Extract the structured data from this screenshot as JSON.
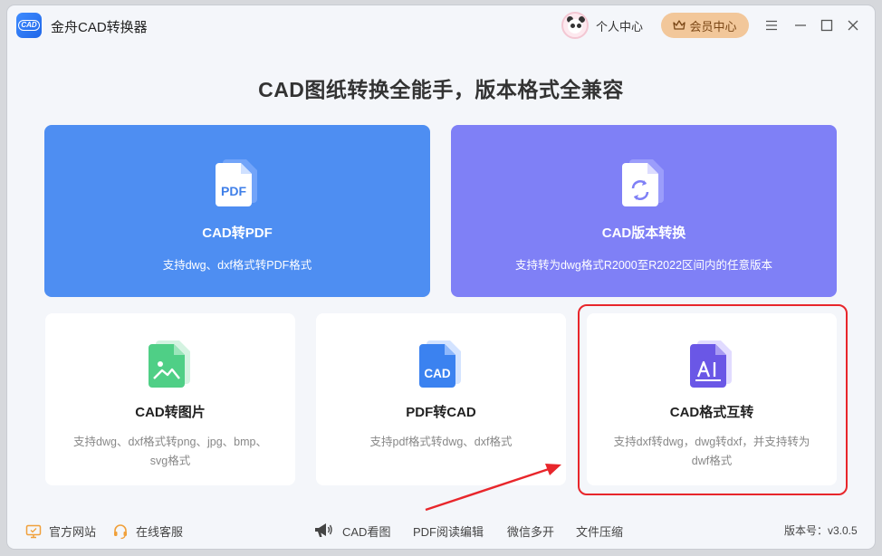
{
  "app": {
    "title": "金舟CAD转换器",
    "logo_text": "CAD"
  },
  "header": {
    "user_center": "个人中心",
    "vip_center": "会员中心"
  },
  "headline": "CAD图纸转换全能手，版本格式全兼容",
  "cards_top": [
    {
      "title": "CAD转PDF",
      "desc": "支持dwg、dxf格式转PDF格式",
      "icon": "pdf-file-icon",
      "icon_text": "PDF",
      "color": "#4e8ef2"
    },
    {
      "title": "CAD版本转换",
      "desc": "支持转为dwg格式R2000至R2022区间内的任意版本",
      "icon": "version-convert-icon",
      "color": "#7f80f6"
    }
  ],
  "cards_bottom": [
    {
      "title": "CAD转图片",
      "desc": "支持dwg、dxf格式转png、jpg、bmp、svg格式",
      "icon": "image-file-icon",
      "color": "#4fcf86"
    },
    {
      "title": "PDF转CAD",
      "desc": "支持pdf格式转dwg、dxf格式",
      "icon": "cad-file-icon",
      "icon_text": "CAD",
      "color": "#3b82f0"
    },
    {
      "title": "CAD格式互转",
      "desc": "支持dxf转dwg，dwg转dxf，并支持转为dwf格式",
      "icon": "format-convert-icon",
      "color": "#6a57e6"
    }
  ],
  "footer": {
    "website": "官方网站",
    "support": "在线客服",
    "links": [
      "CAD看图",
      "PDF阅读编辑",
      "微信多开",
      "文件压缩"
    ],
    "version": "版本号：v3.0.5"
  },
  "colors": {
    "accent_blue": "#4e8ef2",
    "accent_purple": "#7f80f6",
    "vip": "#f2c79a",
    "highlight": "#e8262b"
  }
}
